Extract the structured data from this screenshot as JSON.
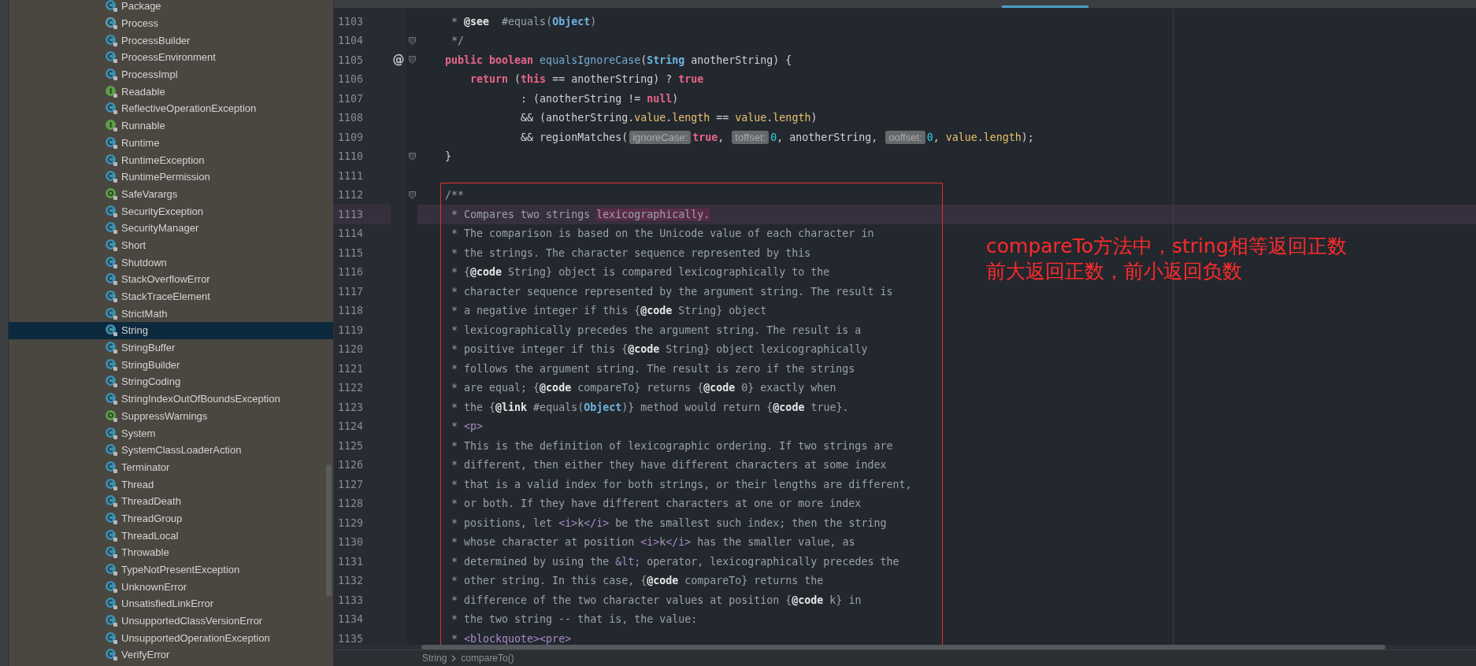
{
  "project_tree": {
    "items": [
      {
        "label": "Package",
        "kind": "class",
        "selected": false
      },
      {
        "label": "Process",
        "kind": "abstract",
        "selected": false
      },
      {
        "label": "ProcessBuilder",
        "kind": "class",
        "selected": false
      },
      {
        "label": "ProcessEnvironment",
        "kind": "class",
        "selected": false
      },
      {
        "label": "ProcessImpl",
        "kind": "class",
        "selected": false
      },
      {
        "label": "Readable",
        "kind": "interface",
        "selected": false
      },
      {
        "label": "ReflectiveOperationException",
        "kind": "class",
        "selected": false
      },
      {
        "label": "Runnable",
        "kind": "interface",
        "selected": false
      },
      {
        "label": "Runtime",
        "kind": "class",
        "selected": false
      },
      {
        "label": "RuntimeException",
        "kind": "class",
        "selected": false
      },
      {
        "label": "RuntimePermission",
        "kind": "class",
        "selected": false
      },
      {
        "label": "SafeVarargs",
        "kind": "annotation",
        "selected": false
      },
      {
        "label": "SecurityException",
        "kind": "class",
        "selected": false
      },
      {
        "label": "SecurityManager",
        "kind": "class",
        "selected": false
      },
      {
        "label": "Short",
        "kind": "class",
        "selected": false
      },
      {
        "label": "Shutdown",
        "kind": "class",
        "selected": false
      },
      {
        "label": "StackOverflowError",
        "kind": "class",
        "selected": false
      },
      {
        "label": "StackTraceElement",
        "kind": "class",
        "selected": false
      },
      {
        "label": "StrictMath",
        "kind": "class",
        "selected": false
      },
      {
        "label": "String",
        "kind": "class",
        "selected": true
      },
      {
        "label": "StringBuffer",
        "kind": "class",
        "selected": false
      },
      {
        "label": "StringBuilder",
        "kind": "class",
        "selected": false
      },
      {
        "label": "StringCoding",
        "kind": "class",
        "selected": false
      },
      {
        "label": "StringIndexOutOfBoundsException",
        "kind": "class",
        "selected": false
      },
      {
        "label": "SuppressWarnings",
        "kind": "annotation",
        "selected": false
      },
      {
        "label": "System",
        "kind": "class",
        "selected": false
      },
      {
        "label": "SystemClassLoaderAction",
        "kind": "class",
        "selected": false
      },
      {
        "label": "Terminator",
        "kind": "class",
        "selected": false
      },
      {
        "label": "Thread",
        "kind": "class",
        "selected": false
      },
      {
        "label": "ThreadDeath",
        "kind": "class",
        "selected": false
      },
      {
        "label": "ThreadGroup",
        "kind": "class",
        "selected": false
      },
      {
        "label": "ThreadLocal",
        "kind": "class",
        "selected": false
      },
      {
        "label": "Throwable",
        "kind": "class",
        "selected": false
      },
      {
        "label": "TypeNotPresentException",
        "kind": "class",
        "selected": false
      },
      {
        "label": "UnknownError",
        "kind": "class",
        "selected": false
      },
      {
        "label": "UnsatisfiedLinkError",
        "kind": "class",
        "selected": false
      },
      {
        "label": "UnsupportedClassVersionError",
        "kind": "class",
        "selected": false
      },
      {
        "label": "UnsupportedOperationException",
        "kind": "class",
        "selected": false
      },
      {
        "label": "VerifyError",
        "kind": "class",
        "selected": false
      }
    ]
  },
  "editor": {
    "lines": [
      {
        "number": "1103",
        "current": false,
        "fold": false,
        "segments": [
          {
            "kind": "comment",
            "text": "     * "
          },
          {
            "kind": "doctag",
            "text": "@see"
          },
          {
            "kind": "comment",
            "text": "  #equals("
          },
          {
            "kind": "type",
            "text": "Object"
          },
          {
            "kind": "comment",
            "text": ")"
          }
        ]
      },
      {
        "number": "1104",
        "current": false,
        "fold": true,
        "segments": [
          {
            "kind": "comment",
            "text": "     */"
          }
        ]
      },
      {
        "number": "1105",
        "current": false,
        "fold": true,
        "marker": "@",
        "segments": [
          {
            "kind": "keyword",
            "text": "    public boolean"
          },
          {
            "kind": "method",
            "text": " equalsIgnoreCase"
          },
          {
            "kind": "plain",
            "text": "("
          },
          {
            "kind": "type",
            "text": "String"
          },
          {
            "kind": "plain",
            "text": " anotherString) {"
          }
        ]
      },
      {
        "number": "1106",
        "current": false,
        "fold": false,
        "segments": [
          {
            "kind": "keyword",
            "text": "        return"
          },
          {
            "kind": "plain",
            "text": " ("
          },
          {
            "kind": "keyword",
            "text": "this"
          },
          {
            "kind": "plain",
            "text": " == anotherString) ? "
          },
          {
            "kind": "keyword",
            "text": "true"
          }
        ]
      },
      {
        "number": "1107",
        "current": false,
        "fold": false,
        "segments": [
          {
            "kind": "plain",
            "text": "                : (anotherString != "
          },
          {
            "kind": "keyword",
            "text": "null"
          },
          {
            "kind": "plain",
            "text": ")"
          }
        ]
      },
      {
        "number": "1108",
        "current": false,
        "fold": false,
        "segments": [
          {
            "kind": "plain",
            "text": "                && (anotherString."
          },
          {
            "kind": "field",
            "text": "value"
          },
          {
            "kind": "plain",
            "text": "."
          },
          {
            "kind": "field",
            "text": "length"
          },
          {
            "kind": "plain",
            "text": " == "
          },
          {
            "kind": "field",
            "text": "value"
          },
          {
            "kind": "plain",
            "text": "."
          },
          {
            "kind": "field",
            "text": "length"
          },
          {
            "kind": "plain",
            "text": ")"
          }
        ]
      },
      {
        "number": "1109",
        "current": false,
        "fold": false,
        "segments": [
          {
            "kind": "plain",
            "text": "                && regionMatches("
          },
          {
            "kind": "hint",
            "text": "ignoreCase:"
          },
          {
            "kind": "keyword",
            "text": "true"
          },
          {
            "kind": "plain",
            "text": ", "
          },
          {
            "kind": "hint",
            "text": "toffset:"
          },
          {
            "kind": "number",
            "text": "0"
          },
          {
            "kind": "plain",
            "text": ", anotherString, "
          },
          {
            "kind": "hint",
            "text": "ooffset:"
          },
          {
            "kind": "number",
            "text": "0"
          },
          {
            "kind": "plain",
            "text": ", "
          },
          {
            "kind": "field",
            "text": "value"
          },
          {
            "kind": "plain",
            "text": "."
          },
          {
            "kind": "field",
            "text": "length"
          },
          {
            "kind": "plain",
            "text": ");"
          }
        ]
      },
      {
        "number": "1110",
        "current": false,
        "fold": true,
        "segments": [
          {
            "kind": "plain",
            "text": "    }"
          }
        ]
      },
      {
        "number": "1111",
        "current": false,
        "fold": false
      },
      {
        "number": "1112",
        "current": false,
        "fold": true,
        "segments": [
          {
            "kind": "comment",
            "text": "    /**"
          }
        ]
      },
      {
        "number": "1113",
        "current": true,
        "fold": false,
        "segments": [
          {
            "kind": "comment",
            "text": "     * Compares two strings "
          },
          {
            "kind": "match",
            "text": "lexicographically."
          }
        ]
      },
      {
        "number": "1114",
        "current": false,
        "fold": false,
        "segments": [
          {
            "kind": "comment",
            "text": "     * The comparison is based on the Unicode value of each character in"
          }
        ]
      },
      {
        "number": "1115",
        "current": false,
        "fold": false,
        "segments": [
          {
            "kind": "comment",
            "text": "     * the strings. The character sequence represented by this"
          }
        ]
      },
      {
        "number": "1116",
        "current": false,
        "fold": false,
        "segments": [
          {
            "kind": "comment",
            "text": "     * {"
          },
          {
            "kind": "doctag",
            "text": "@code"
          },
          {
            "kind": "comment",
            "text": " String} object is compared lexicographically to the"
          }
        ]
      },
      {
        "number": "1117",
        "current": false,
        "fold": false,
        "segments": [
          {
            "kind": "comment",
            "text": "     * character sequence represented by the argument string. The result is"
          }
        ]
      },
      {
        "number": "1118",
        "current": false,
        "fold": false,
        "segments": [
          {
            "kind": "comment",
            "text": "     * a negative integer if this {"
          },
          {
            "kind": "doctag",
            "text": "@code"
          },
          {
            "kind": "comment",
            "text": " String} object"
          }
        ]
      },
      {
        "number": "1119",
        "current": false,
        "fold": false,
        "segments": [
          {
            "kind": "comment",
            "text": "     * lexicographically precedes the argument string. The result is a"
          }
        ]
      },
      {
        "number": "1120",
        "current": false,
        "fold": false,
        "segments": [
          {
            "kind": "comment",
            "text": "     * positive integer if this {"
          },
          {
            "kind": "doctag",
            "text": "@code"
          },
          {
            "kind": "comment",
            "text": " String} object lexicographically"
          }
        ]
      },
      {
        "number": "1121",
        "current": false,
        "fold": false,
        "segments": [
          {
            "kind": "comment",
            "text": "     * follows the argument string. The result is zero if the strings"
          }
        ]
      },
      {
        "number": "1122",
        "current": false,
        "fold": false,
        "segments": [
          {
            "kind": "comment",
            "text": "     * are equal; {"
          },
          {
            "kind": "doctag",
            "text": "@code"
          },
          {
            "kind": "comment",
            "text": " compareTo} returns {"
          },
          {
            "kind": "doctag",
            "text": "@code"
          },
          {
            "kind": "comment",
            "text": " 0} exactly when"
          }
        ]
      },
      {
        "number": "1123",
        "current": false,
        "fold": false,
        "segments": [
          {
            "kind": "comment",
            "text": "     * the {"
          },
          {
            "kind": "doctag",
            "text": "@link"
          },
          {
            "kind": "comment",
            "text": " #equals("
          },
          {
            "kind": "type",
            "text": "Object"
          },
          {
            "kind": "comment",
            "text": ")} method would return {"
          },
          {
            "kind": "doctag",
            "text": "@code"
          },
          {
            "kind": "comment",
            "text": " true}."
          }
        ]
      },
      {
        "number": "1124",
        "current": false,
        "fold": false,
        "segments": [
          {
            "kind": "comment",
            "text": "     * "
          },
          {
            "kind": "tag",
            "text": "<p>"
          }
        ]
      },
      {
        "number": "1125",
        "current": false,
        "fold": false,
        "segments": [
          {
            "kind": "comment",
            "text": "     * This is the definition of lexicographic ordering. If two strings are"
          }
        ]
      },
      {
        "number": "1126",
        "current": false,
        "fold": false,
        "segments": [
          {
            "kind": "comment",
            "text": "     * different, then either they have different characters at some index"
          }
        ]
      },
      {
        "number": "1127",
        "current": false,
        "fold": false,
        "segments": [
          {
            "kind": "comment",
            "text": "     * that is a valid index for both strings, or their lengths are different,"
          }
        ]
      },
      {
        "number": "1128",
        "current": false,
        "fold": false,
        "segments": [
          {
            "kind": "comment",
            "text": "     * or both. If they have different characters at one or more index"
          }
        ]
      },
      {
        "number": "1129",
        "current": false,
        "fold": false,
        "segments": [
          {
            "kind": "comment",
            "text": "     * positions, let "
          },
          {
            "kind": "tag",
            "text": "<i>"
          },
          {
            "kind": "comment",
            "text": "k"
          },
          {
            "kind": "tag",
            "text": "</i>"
          },
          {
            "kind": "comment",
            "text": " be the smallest such index; then the string"
          }
        ]
      },
      {
        "number": "1130",
        "current": false,
        "fold": false,
        "segments": [
          {
            "kind": "comment",
            "text": "     * whose character at position "
          },
          {
            "kind": "tag",
            "text": "<i>"
          },
          {
            "kind": "comment",
            "text": "k"
          },
          {
            "kind": "tag",
            "text": "</i>"
          },
          {
            "kind": "comment",
            "text": " has the smaller value, as"
          }
        ]
      },
      {
        "number": "1131",
        "current": false,
        "fold": false,
        "segments": [
          {
            "kind": "comment",
            "text": "     * determined by using the "
          },
          {
            "kind": "tag",
            "text": "&lt;"
          },
          {
            "kind": "comment",
            "text": " operator, lexicographically precedes the"
          }
        ]
      },
      {
        "number": "1132",
        "current": false,
        "fold": false,
        "segments": [
          {
            "kind": "comment",
            "text": "     * other string. In this case, {"
          },
          {
            "kind": "doctag",
            "text": "@code"
          },
          {
            "kind": "comment",
            "text": " compareTo} returns the"
          }
        ]
      },
      {
        "number": "1133",
        "current": false,
        "fold": false,
        "segments": [
          {
            "kind": "comment",
            "text": "     * difference of the two character values at position {"
          },
          {
            "kind": "doctag",
            "text": "@code"
          },
          {
            "kind": "comment",
            "text": " k} in"
          }
        ]
      },
      {
        "number": "1134",
        "current": false,
        "fold": false,
        "segments": [
          {
            "kind": "comment",
            "text": "     * the two string -- that is, the value:"
          }
        ]
      },
      {
        "number": "1135",
        "current": false,
        "fold": false,
        "segments": [
          {
            "kind": "comment",
            "text": "     * "
          },
          {
            "kind": "tag",
            "text": "<blockquote><pre>"
          }
        ]
      }
    ]
  },
  "annotation": {
    "lines": [
      "compareTo方法中，string相等返回正数",
      "前大返回正数，前小返回负数"
    ]
  },
  "breadcrumbs": [
    "String",
    "compareTo()"
  ]
}
